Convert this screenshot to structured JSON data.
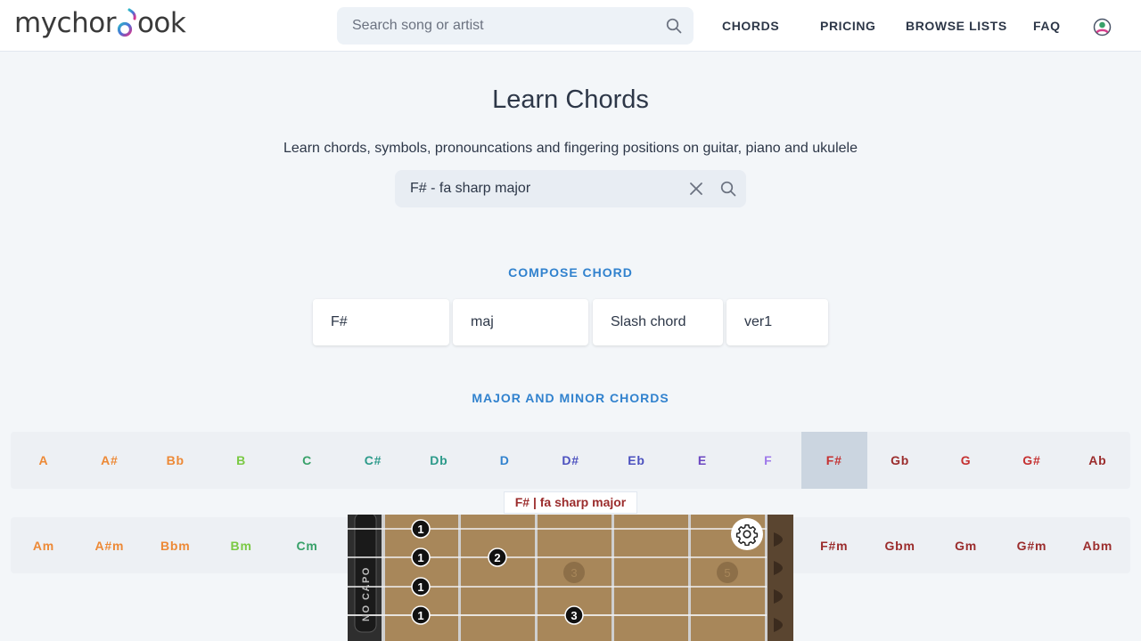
{
  "header": {
    "logo_left": "mychor",
    "logo_right": "ook",
    "search_placeholder": "Search song or artist",
    "nav": [
      "CHORDS",
      "PRICING",
      "BROWSE LISTS",
      "FAQ"
    ]
  },
  "main": {
    "title": "Learn Chords",
    "subtitle": "Learn chords, symbols, pronouncations and fingering positions on guitar, piano and ukulele",
    "chord_search_value": "F# - fa sharp major"
  },
  "compose": {
    "title": "COMPOSE CHORD",
    "root": "F#",
    "quality": "maj",
    "slash": "Slash chord",
    "version": "ver1"
  },
  "major_minor": {
    "title": "MAJOR AND MINOR CHORDS",
    "major": [
      {
        "label": "A",
        "color": "#ed8936"
      },
      {
        "label": "A#",
        "color": "#ed8936"
      },
      {
        "label": "Bb",
        "color": "#ed8936"
      },
      {
        "label": "B",
        "color": "#7ac943"
      },
      {
        "label": "C",
        "color": "#38a169"
      },
      {
        "label": "C#",
        "color": "#2c9a8a"
      },
      {
        "label": "Db",
        "color": "#2c9a8a"
      },
      {
        "label": "D",
        "color": "#3182ce"
      },
      {
        "label": "D#",
        "color": "#4c51bf"
      },
      {
        "label": "Eb",
        "color": "#4c51bf"
      },
      {
        "label": "E",
        "color": "#6b46c1"
      },
      {
        "label": "F",
        "color": "#9f7aea"
      },
      {
        "label": "F#",
        "color": "#c53030"
      },
      {
        "label": "Gb",
        "color": "#9b2c2c"
      },
      {
        "label": "G",
        "color": "#c53030"
      },
      {
        "label": "G#",
        "color": "#c53030"
      },
      {
        "label": "Ab",
        "color": "#9b2c2c"
      }
    ],
    "minor_left": [
      {
        "label": "Am",
        "color": "#ed8936"
      },
      {
        "label": "A#m",
        "color": "#ed8936"
      },
      {
        "label": "Bbm",
        "color": "#ed8936"
      },
      {
        "label": "Bm",
        "color": "#7ac943"
      },
      {
        "label": "Cm",
        "color": "#38a169"
      }
    ],
    "minor_right": [
      {
        "label": "F#m",
        "color": "#9b2c2c"
      },
      {
        "label": "Gbm",
        "color": "#9b2c2c"
      },
      {
        "label": "Gm",
        "color": "#9b2c2c"
      },
      {
        "label": "G#m",
        "color": "#9b2c2c"
      },
      {
        "label": "Abm",
        "color": "#9b2c2c"
      }
    ],
    "active": "F#"
  },
  "diagram": {
    "label": "F# | fa sharp major",
    "capo_text": "NO CAPO",
    "fret_markers": [
      "3",
      "5"
    ],
    "fingers": [
      "1",
      "1",
      "1",
      "1",
      "2",
      "3"
    ]
  }
}
